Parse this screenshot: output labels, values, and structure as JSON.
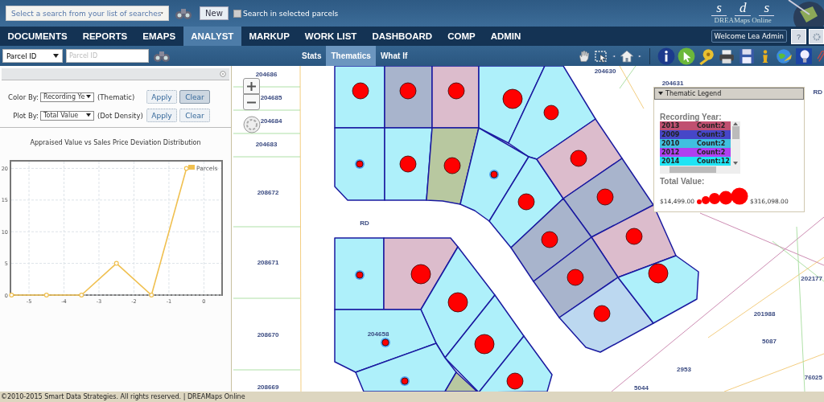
{
  "header": {
    "search_select": {
      "value": "Select a search from your list of searches"
    },
    "new_button": "New",
    "search_selected": {
      "label": "Search in selected parcels",
      "checked": false
    },
    "logo": {
      "letters": [
        "s",
        "d",
        "s"
      ],
      "subtitle": "DREAMaps Online"
    }
  },
  "nav": {
    "tabs": [
      {
        "label": "DOCUMENTS",
        "selected": false
      },
      {
        "label": "REPORTS",
        "selected": false
      },
      {
        "label": "EMAPS",
        "selected": false
      },
      {
        "label": "ANALYST",
        "selected": true
      },
      {
        "label": "MARKUP",
        "selected": false
      },
      {
        "label": "WORK LIST",
        "selected": false
      },
      {
        "label": "DASHBOARD",
        "selected": false
      },
      {
        "label": "COMP",
        "selected": false
      },
      {
        "label": "ADMIN",
        "selected": false
      }
    ],
    "welcome": "Welcome Lea Admin",
    "help_button": "?"
  },
  "toolbar": {
    "field_select": {
      "value": "Parcel ID"
    },
    "field": {
      "placeholder": "Parcel ID"
    },
    "tabs": [
      {
        "label": "Stats",
        "selected": false
      },
      {
        "label": "Thematics",
        "selected": true
      },
      {
        "label": "What If",
        "selected": false
      }
    ]
  },
  "panel": {
    "rows": [
      {
        "label": "Color By:",
        "select": "Recording Ye",
        "mode": "(Thematic)",
        "apply": "Apply",
        "clear": "Clear",
        "clear_pressed": true
      },
      {
        "label": "Plot By:",
        "select": "Total Value",
        "mode": "(Dot Density)",
        "apply": "Apply",
        "clear": "Clear",
        "clear_pressed": false
      }
    ],
    "chart_data": {
      "type": "line",
      "title": "Appraised Value vs Sales Price Deviation Distribution",
      "x": [
        -5.5,
        -4.5,
        -3.5,
        -2.5,
        -1.5,
        -0.5
      ],
      "grid": true,
      "series": [
        {
          "name": "Parcels",
          "color": "#f0c050",
          "marker": "circle",
          "values": [
            0,
            0,
            0,
            5,
            0,
            20
          ]
        }
      ],
      "xlim": [
        -5.53,
        0.52
      ],
      "ylim": [
        0,
        21.2
      ],
      "xticks": [
        -5,
        -4,
        -3,
        -2,
        -1,
        0
      ],
      "yticks": [
        0,
        5,
        10,
        15,
        20
      ]
    }
  },
  "map": {
    "labels": [
      "204686",
      "204685",
      "204684",
      "204683",
      "208672",
      "208671",
      "208670",
      "208669",
      "RD",
      "204630",
      "204631",
      "RD",
      "204658",
      "202177",
      "201988",
      "5087",
      "2953",
      "5044",
      "76025"
    ]
  },
  "legend": {
    "title": "Thematic Legend",
    "section": "Recording Year:",
    "entries": [
      {
        "year": "2013",
        "count": "Count:2",
        "color": "#c05070"
      },
      {
        "year": "2009",
        "count": "Count:3",
        "color": "#4646c8"
      },
      {
        "year": "2010",
        "count": "Count:2",
        "color": "#40c0e0"
      },
      {
        "year": "2012",
        "count": "Count:2",
        "color": "#b040f0"
      },
      {
        "year": "2014",
        "count": "Count:12",
        "color": "#20e4f4"
      }
    ],
    "size_title": "Total Value:",
    "min": "$14,499.00",
    "max": "$316,098.00"
  },
  "footer": "©2010-2015 Smart Data Strategies. All rights reserved. | DREAMaps Online"
}
